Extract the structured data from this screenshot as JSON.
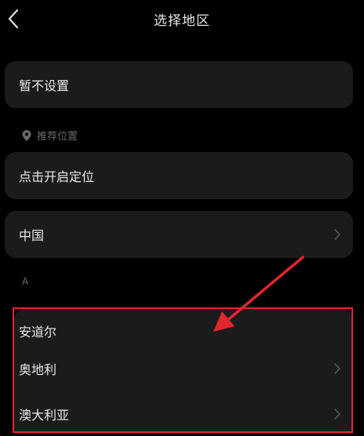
{
  "header": {
    "title": "选择地区",
    "back_icon": "chevron-left-icon"
  },
  "options": {
    "no_setting": "暂不设置"
  },
  "recommended": {
    "label": "推荐位置",
    "icon": "location-pin-icon",
    "enable_location": "点击开启定位"
  },
  "current_country": {
    "label": "中国",
    "icon": "chevron-right-icon"
  },
  "index_letter": "A",
  "regions": [
    {
      "label": "安道尔",
      "has_chevron": false
    },
    {
      "label": "奥地利",
      "has_chevron": true
    },
    {
      "label": "澳大利亚",
      "has_chevron": true
    }
  ],
  "colors": {
    "background": "#000000",
    "card": "#1b1b1b",
    "text": "#e9e9e9",
    "muted": "#6a6a6a",
    "annotation_red": "#e3262e"
  }
}
